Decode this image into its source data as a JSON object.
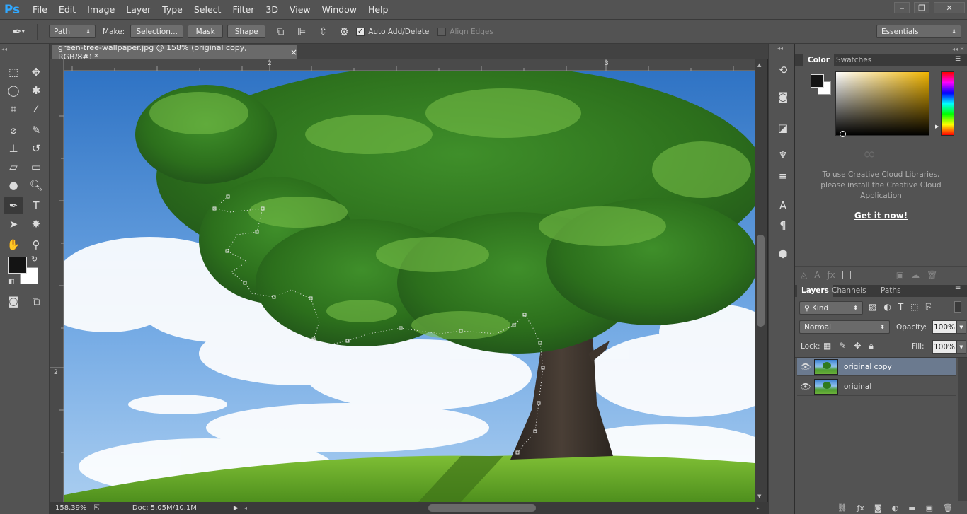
{
  "app": {
    "logo": "Ps"
  },
  "menu": [
    "File",
    "Edit",
    "Image",
    "Layer",
    "Type",
    "Select",
    "Filter",
    "3D",
    "View",
    "Window",
    "Help"
  ],
  "window_controls": {
    "minimize": "‒",
    "restore": "❐",
    "close": "✕"
  },
  "options": {
    "mode": "Path",
    "make_label": "Make:",
    "selection_btn": "Selection...",
    "mask_btn": "Mask",
    "shape_btn": "Shape",
    "auto_add_delete": "Auto Add/Delete",
    "auto_add_checked": true,
    "align_edges": "Align Edges",
    "workspace": "Essentials"
  },
  "document": {
    "tab_title": "green-tree-wallpaper.jpg @ 158% (original copy, RGB/8#) *",
    "close": "×",
    "ruler_top_labels": [
      "2",
      "3"
    ],
    "ruler_left_labels": [
      "2"
    ]
  },
  "status": {
    "zoom": "158.39%",
    "doc": "Doc: 5.05M/10.1M"
  },
  "color_panel": {
    "tabs": [
      "Color",
      "Swatches"
    ],
    "fg": "#141414",
    "bg": "#ffffff"
  },
  "libraries": {
    "message_line1": "To use Creative Cloud Libraries,",
    "message_line2": "please install the Creative Cloud",
    "message_line3": "Application",
    "link": "Get it now!"
  },
  "layers_panel": {
    "tabs": [
      "Layers",
      "Channels",
      "Paths"
    ],
    "filter": "Kind",
    "blend_mode": "Normal",
    "opacity_label": "Opacity:",
    "opacity": "100%",
    "lock_label": "Lock:",
    "fill_label": "Fill:",
    "fill": "100%",
    "layers": [
      {
        "name": "original copy",
        "selected": true
      },
      {
        "name": "original",
        "selected": false
      }
    ]
  },
  "colors": {
    "accent": "#31a8ff",
    "ui_bg": "#535353",
    "selected_layer": "#6b7a8f"
  }
}
